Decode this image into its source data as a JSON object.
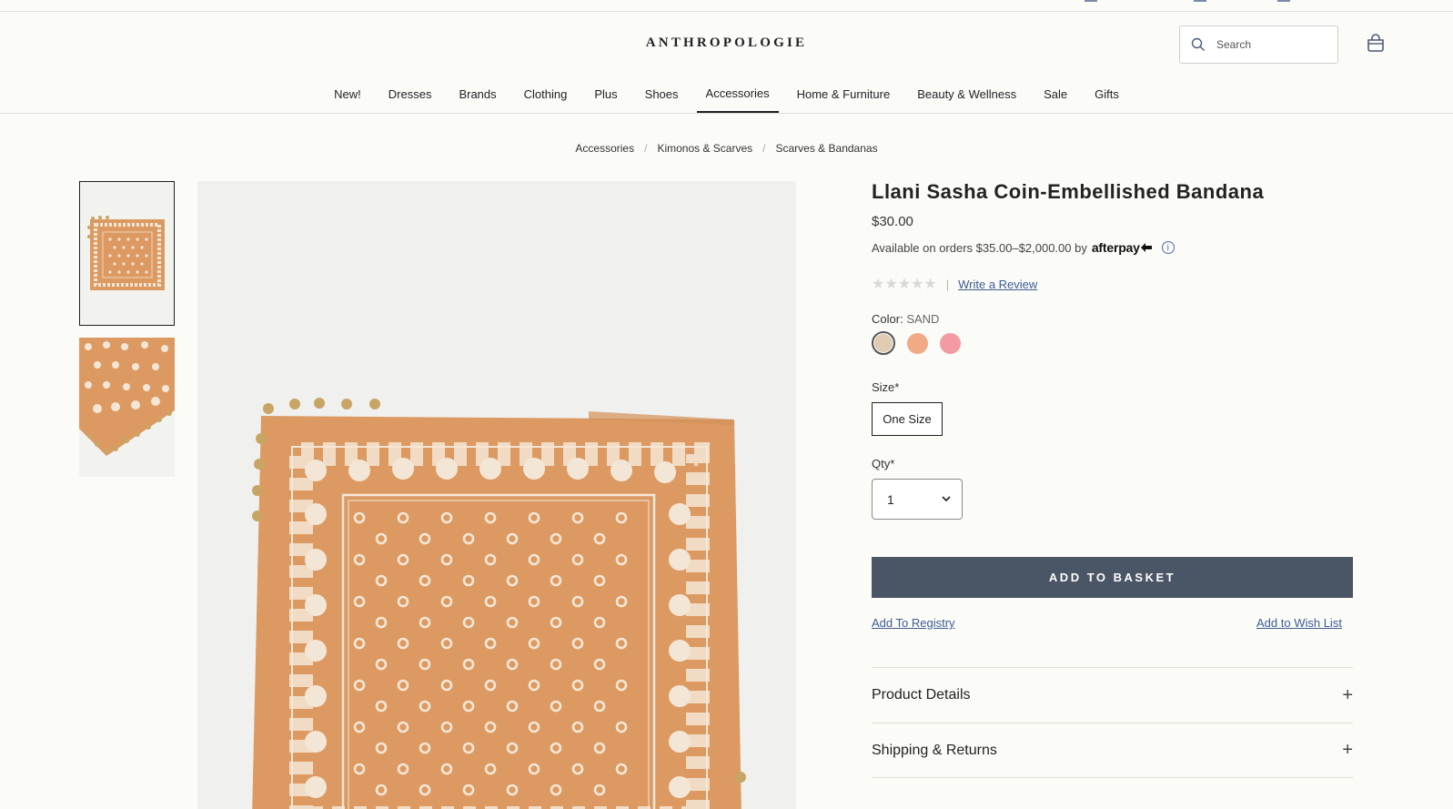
{
  "header": {
    "logo": "ANTHROPOLOGIE",
    "search_placeholder": "Search"
  },
  "nav": {
    "items": [
      "New!",
      "Dresses",
      "Brands",
      "Clothing",
      "Plus",
      "Shoes",
      "Accessories",
      "Home & Furniture",
      "Beauty & Wellness",
      "Sale",
      "Gifts"
    ],
    "active": "Accessories"
  },
  "breadcrumb": [
    "Accessories",
    "Kimonos & Scarves",
    "Scarves & Bandanas"
  ],
  "product": {
    "title": "Llani Sasha Coin-Embellished Bandana",
    "price": "$30.00",
    "afterpay_text": "Available on orders $35.00–$2,000.00 by",
    "afterpay_brand": "afterpay",
    "rating_stars": "★★★★★",
    "rating_sep": "|",
    "write_review": "Write a Review",
    "color_label": "Color:",
    "color_value": "SAND",
    "colors": [
      "#e2cbb3",
      "#f2a985",
      "#f49aa4"
    ],
    "size_label": "Size*",
    "size_option": "One Size",
    "qty_label": "Qty*",
    "qty_value": "1",
    "add_to_basket": "ADD TO BASKET",
    "add_to_registry": "Add To Registry",
    "add_to_wishlist": "Add to Wish List",
    "accordions": [
      "Product Details",
      "Shipping & Returns"
    ]
  },
  "colors": {
    "bandana": "#dc9a62",
    "bandana_print": "#f4e6d6",
    "button": "#4a5566",
    "link": "#3d5d93"
  }
}
